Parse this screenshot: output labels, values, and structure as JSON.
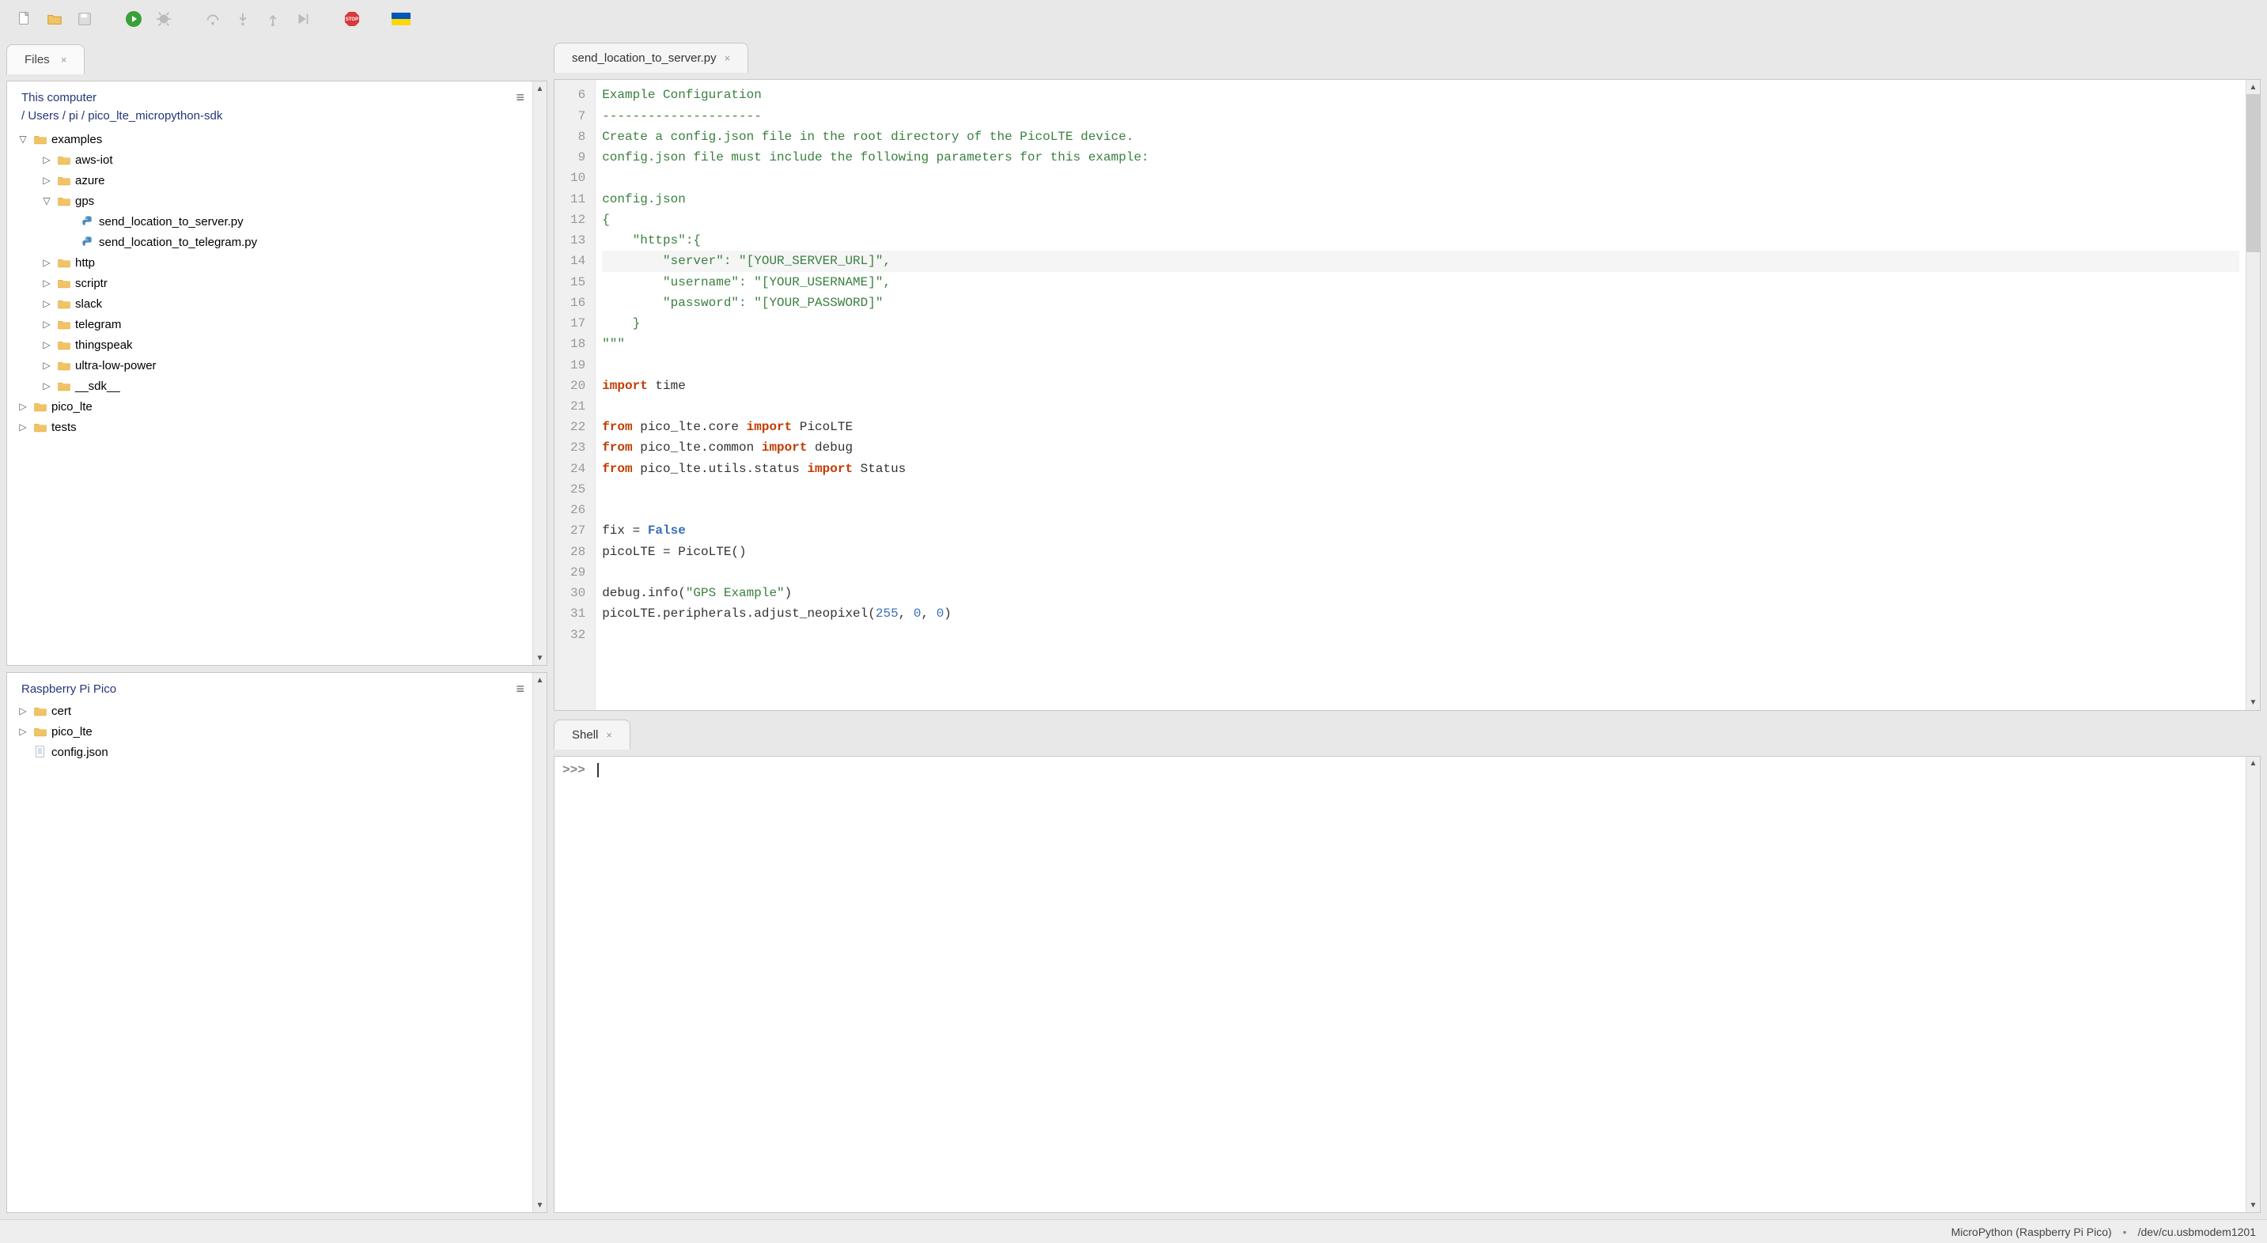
{
  "toolbar": {
    "icons": [
      "new-file",
      "open-file",
      "save-file",
      "run",
      "debug",
      "step-over",
      "step-into",
      "step-out",
      "resume",
      "stop",
      "support"
    ]
  },
  "files_tab": "Files",
  "this_computer": "This computer",
  "breadcrumb": [
    "/",
    "Users",
    "/",
    "pi",
    "/",
    "pico_lte_micropython-sdk"
  ],
  "tree": {
    "examples": "examples",
    "aws_iot": "aws-iot",
    "azure": "azure",
    "gps": "gps",
    "f_server": "send_location_to_server.py",
    "f_telegram": "send_location_to_telegram.py",
    "http": "http",
    "scriptr": "scriptr",
    "slack": "slack",
    "telegram": "telegram",
    "thingspeak": "thingspeak",
    "ulp": "ultra-low-power",
    "sdk": "__sdk__",
    "pico_lte": "pico_lte",
    "tests": "tests"
  },
  "device_panel": "Raspberry Pi Pico",
  "device_tree": {
    "cert": "cert",
    "pico_lte": "pico_lte",
    "config": "config.json"
  },
  "editor_tab": "send_location_to_server.py",
  "code_lines": [
    {
      "n": 6,
      "seg": [
        [
          "c-str",
          "Example Configuration"
        ]
      ]
    },
    {
      "n": 7,
      "seg": [
        [
          "c-str",
          "---------------------"
        ]
      ]
    },
    {
      "n": 8,
      "seg": [
        [
          "c-str",
          "Create a config.json file in the root directory of the PicoLTE device."
        ]
      ]
    },
    {
      "n": 9,
      "seg": [
        [
          "c-str",
          "config.json file must include the following parameters for this example:"
        ]
      ]
    },
    {
      "n": 10,
      "seg": [
        [
          "c-str",
          ""
        ]
      ]
    },
    {
      "n": 11,
      "seg": [
        [
          "c-str",
          "config.json"
        ]
      ]
    },
    {
      "n": 12,
      "seg": [
        [
          "c-str",
          "{"
        ]
      ]
    },
    {
      "n": 13,
      "seg": [
        [
          "c-str",
          "    \"https\":{"
        ]
      ]
    },
    {
      "n": 14,
      "seg": [
        [
          "c-str",
          "        \"server\": \"[YOUR_SERVER_URL]\","
        ]
      ],
      "hl": true
    },
    {
      "n": 15,
      "seg": [
        [
          "c-str",
          "        \"username\": \"[YOUR_USERNAME]\","
        ]
      ]
    },
    {
      "n": 16,
      "seg": [
        [
          "c-str",
          "        \"password\": \"[YOUR_PASSWORD]\""
        ]
      ]
    },
    {
      "n": 17,
      "seg": [
        [
          "c-str",
          "    }"
        ]
      ]
    },
    {
      "n": 18,
      "seg": [
        [
          "c-str",
          "\"\"\""
        ]
      ]
    },
    {
      "n": 19,
      "seg": [
        [
          "c-text",
          ""
        ]
      ]
    },
    {
      "n": 20,
      "seg": [
        [
          "c-kw",
          "import"
        ],
        [
          "c-text",
          " time"
        ]
      ]
    },
    {
      "n": 21,
      "seg": [
        [
          "c-text",
          ""
        ]
      ]
    },
    {
      "n": 22,
      "seg": [
        [
          "c-kw",
          "from"
        ],
        [
          "c-text",
          " pico_lte.core "
        ],
        [
          "c-kw",
          "import"
        ],
        [
          "c-text",
          " PicoLTE"
        ]
      ]
    },
    {
      "n": 23,
      "seg": [
        [
          "c-kw",
          "from"
        ],
        [
          "c-text",
          " pico_lte.common "
        ],
        [
          "c-kw",
          "import"
        ],
        [
          "c-text",
          " debug"
        ]
      ]
    },
    {
      "n": 24,
      "seg": [
        [
          "c-kw",
          "from"
        ],
        [
          "c-text",
          " pico_lte.utils.status "
        ],
        [
          "c-kw",
          "import"
        ],
        [
          "c-text",
          " Status"
        ]
      ]
    },
    {
      "n": 25,
      "seg": [
        [
          "c-text",
          ""
        ]
      ]
    },
    {
      "n": 26,
      "seg": [
        [
          "c-text",
          ""
        ]
      ]
    },
    {
      "n": 27,
      "seg": [
        [
          "c-text",
          "fix = "
        ],
        [
          "c-bool",
          "False"
        ]
      ]
    },
    {
      "n": 28,
      "seg": [
        [
          "c-text",
          "picoLTE = PicoLTE()"
        ]
      ]
    },
    {
      "n": 29,
      "seg": [
        [
          "c-text",
          ""
        ]
      ]
    },
    {
      "n": 30,
      "seg": [
        [
          "c-text",
          "debug.info("
        ],
        [
          "c-str",
          "\"GPS Example\""
        ],
        [
          "c-text",
          ")"
        ]
      ]
    },
    {
      "n": 31,
      "seg": [
        [
          "c-text",
          "picoLTE.peripherals.adjust_neopixel("
        ],
        [
          "c-num",
          "255"
        ],
        [
          "c-text",
          ", "
        ],
        [
          "c-num",
          "0"
        ],
        [
          "c-text",
          ", "
        ],
        [
          "c-num",
          "0"
        ],
        [
          "c-text",
          ")"
        ]
      ]
    },
    {
      "n": 32,
      "seg": [
        [
          "c-text",
          ""
        ]
      ]
    }
  ],
  "shell_tab": "Shell",
  "shell_prompt": ">>>",
  "status": {
    "interpreter": "MicroPython (Raspberry Pi Pico)",
    "port": "/dev/cu.usbmodem1201"
  }
}
